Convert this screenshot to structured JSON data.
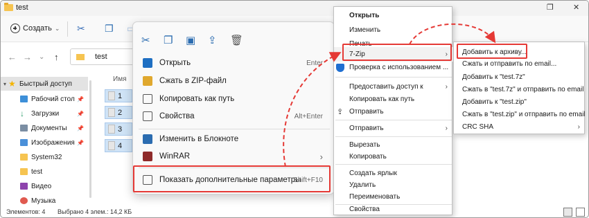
{
  "window": {
    "title": "test",
    "close_glyph": "✕",
    "restore_glyph": "❐"
  },
  "toolbar": {
    "create_label": "Создать",
    "create_caret": "⌄"
  },
  "address": {
    "path_label": "test",
    "back": "←",
    "forward": "→",
    "caret": "⌄",
    "up": "↑"
  },
  "nav_pane": {
    "items": [
      {
        "label": "Быстрый доступ",
        "color": "#f4b400"
      },
      {
        "label": "Рабочий стол",
        "color": "#3d8fd8"
      },
      {
        "label": "Загрузки",
        "color": "#2a9d6a"
      },
      {
        "label": "Документы",
        "color": "#7b8ea3"
      },
      {
        "label": "Изображения",
        "color": "#4a90d9"
      },
      {
        "label": "System32",
        "color": "#f6c451"
      },
      {
        "label": "test",
        "color": "#f6c451"
      },
      {
        "label": "Видео",
        "color": "#8e44ad"
      },
      {
        "label": "Музыка",
        "color": "#e05a4f"
      }
    ]
  },
  "files": {
    "column_name": "Имя",
    "items": [
      "1",
      "2",
      "3",
      "4"
    ]
  },
  "status": {
    "count": "Элементов: 4",
    "selection": "Выбрано 4 элем.: 14,2 КБ"
  },
  "menu11": {
    "items": [
      {
        "label": "Открыть",
        "shortcut": "Enter",
        "icon_color": "#1e6fc2"
      },
      {
        "label": "Сжать в ZIP-файл",
        "shortcut": "",
        "icon_color": "#e0a82e"
      },
      {
        "label": "Копировать как путь",
        "shortcut": "",
        "icon_color": "#555555"
      },
      {
        "label": "Свойства",
        "shortcut": "Alt+Enter",
        "icon_color": "#555555"
      },
      {
        "label": "Изменить в Блокноте",
        "shortcut": "",
        "icon_color": "#2b6cb0"
      },
      {
        "label": "WinRAR",
        "shortcut": "",
        "icon_color": "#8e2a2a"
      },
      {
        "label": "Показать дополнительные параметры",
        "shortcut": "Shift+F10",
        "icon_color": "#555555"
      }
    ],
    "submenu_arrow": "›"
  },
  "classic_menu": {
    "items": [
      {
        "label": "Открыть",
        "bold": true
      },
      {
        "label": "Изменить"
      },
      {
        "label": "Печать"
      },
      {
        "label": "7-Zip",
        "submenu": true
      },
      {
        "label": "Проверка с использованием ..."
      },
      {
        "label": "Предоставить доступ к",
        "submenu": true
      },
      {
        "label": "Копировать как путь"
      },
      {
        "label": "Отправить"
      },
      {
        "label": "Отправить",
        "submenu": true
      },
      {
        "label": "Вырезать"
      },
      {
        "label": "Копировать"
      },
      {
        "label": "Создать ярлык"
      },
      {
        "label": "Удалить"
      },
      {
        "label": "Переименовать"
      },
      {
        "label": "Свойства"
      }
    ],
    "arrow": "›"
  },
  "zip_submenu": {
    "items": [
      {
        "label": "Добавить к архиву..."
      },
      {
        "label": "Сжать и отправить по email..."
      },
      {
        "label": "Добавить к \"test.7z\""
      },
      {
        "label": "Сжать в \"test.7z\" и отправить по email"
      },
      {
        "label": "Добавить к \"test.zip\""
      },
      {
        "label": "Сжать в \"test.zip\" и отправить по email"
      },
      {
        "label": "CRC SHA",
        "submenu": true
      }
    ],
    "arrow": "›"
  },
  "colors": {
    "highlight": "#e53935"
  }
}
